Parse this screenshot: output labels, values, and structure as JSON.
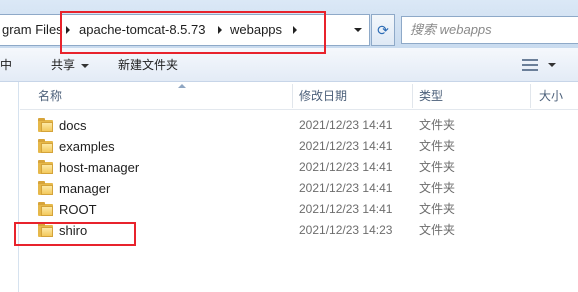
{
  "address_bar": {
    "crumbs": [
      "gram Files",
      "apache-tomcat-8.5.73",
      "webapps"
    ],
    "refresh_glyph": "⟳"
  },
  "search": {
    "placeholder": "搜索 webapps"
  },
  "toolbar": {
    "left_partial": "中",
    "share_label": "共享",
    "new_folder_label": "新建文件夹",
    "view_icon": "view-list-icon"
  },
  "columns": {
    "name": "名称",
    "date": "修改日期",
    "type": "类型",
    "size": "大小"
  },
  "files": [
    {
      "name": "docs",
      "date": "2021/12/23 14:41",
      "type": "文件夹"
    },
    {
      "name": "examples",
      "date": "2021/12/23 14:41",
      "type": "文件夹"
    },
    {
      "name": "host-manager",
      "date": "2021/12/23 14:41",
      "type": "文件夹"
    },
    {
      "name": "manager",
      "date": "2021/12/23 14:41",
      "type": "文件夹"
    },
    {
      "name": "ROOT",
      "date": "2021/12/23 14:41",
      "type": "文件夹"
    },
    {
      "name": "shiro",
      "date": "2021/12/23 14:23",
      "type": "文件夹"
    }
  ],
  "colors": {
    "annotation_red": "#e8232c",
    "folder_yellow": "#f3c95c",
    "header_text": "#4c607a"
  }
}
